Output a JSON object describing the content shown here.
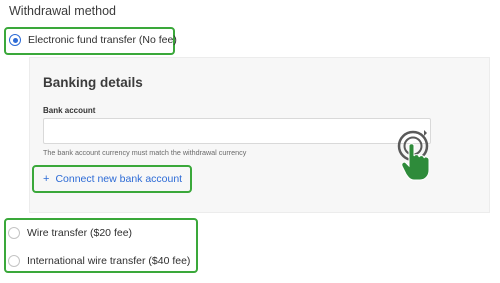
{
  "section_title": "Withdrawal method",
  "methods": [
    {
      "label": "Electronic fund transfer (No fee)",
      "selected": true
    },
    {
      "label": "Wire transfer ($20 fee)",
      "selected": false
    },
    {
      "label": "International wire transfer ($40 fee)",
      "selected": false
    }
  ],
  "banking": {
    "title": "Banking details",
    "field_label": "Bank account",
    "field_value": "",
    "hint": "The bank account currency must match the withdrawal currency",
    "connect_plus": "+",
    "connect_label": "Connect new bank account"
  },
  "colors": {
    "accent": "#2d6bd6",
    "highlight": "#3aa83a",
    "hand": "#2e8b3a"
  },
  "icons": [
    "tap-hand-icon",
    "plus-icon"
  ]
}
